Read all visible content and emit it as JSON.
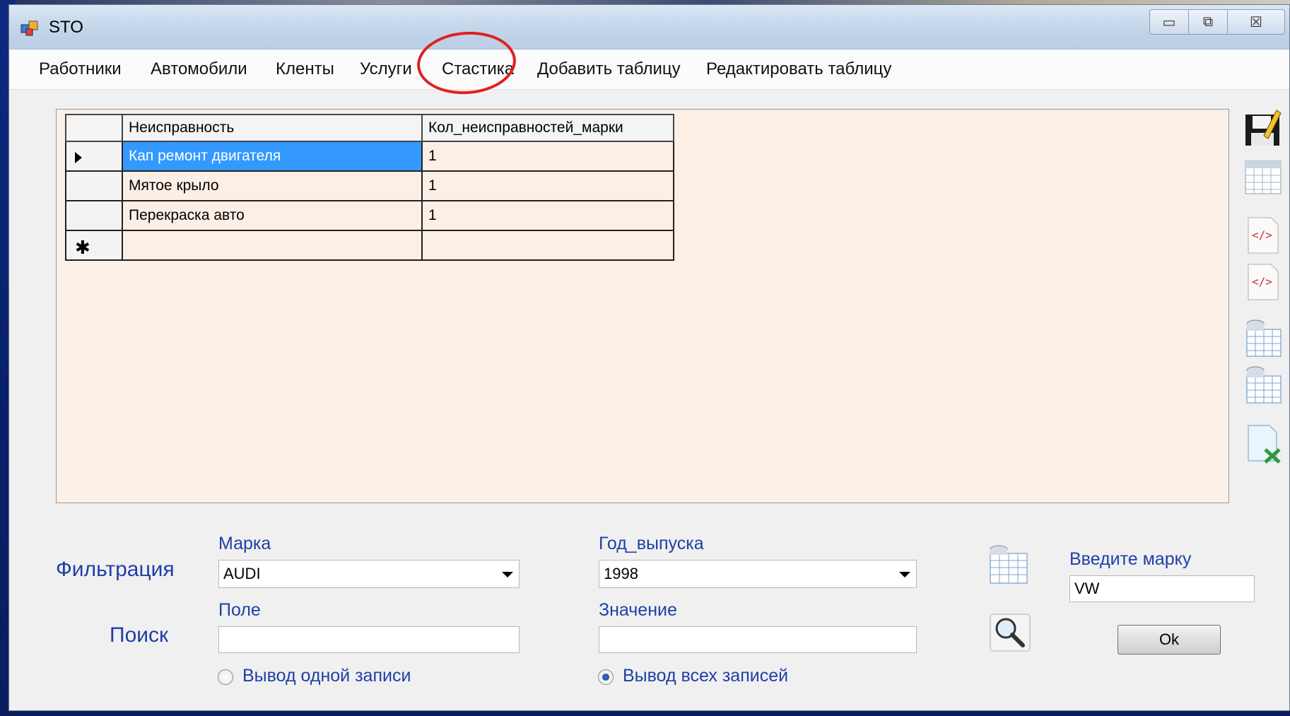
{
  "window": {
    "title": "STO"
  },
  "menu": {
    "items": [
      "Работники",
      "Автомобили",
      "Кленты",
      "Услуги",
      "Стастика",
      "Добавить таблицу",
      "Редактировать таблицу"
    ]
  },
  "grid": {
    "columns": [
      "Неисправность",
      "Кол_неисправностей_марки"
    ],
    "rows": [
      {
        "fault": "Кап ремонт двигателя",
        "count": "1"
      },
      {
        "fault": "Мятое крыло",
        "count": "1"
      },
      {
        "fault": "Перекраска авто",
        "count": "1"
      }
    ],
    "new_row_marker": "✱"
  },
  "filter": {
    "section_label": "Фильтрация",
    "brand_label": "Марка",
    "brand_value": "AUDI",
    "year_label": "Год_выпуска",
    "year_value": "1998"
  },
  "search": {
    "section_label": "Поиск",
    "field_label": "Поле",
    "field_value": "",
    "value_label": "Значение",
    "value_value": "",
    "radio_one_label": "Вывод одной записи",
    "radio_all_label": "Вывод всех записей",
    "radio_selected": "all"
  },
  "brand_input": {
    "label": "Введите марку",
    "value": "VW",
    "ok_label": "Ok"
  },
  "colors": {
    "selection": "#3399ff",
    "grid_bg": "#fcefe6",
    "label_blue": "#1f3fa8",
    "annotation": "#e02020"
  }
}
